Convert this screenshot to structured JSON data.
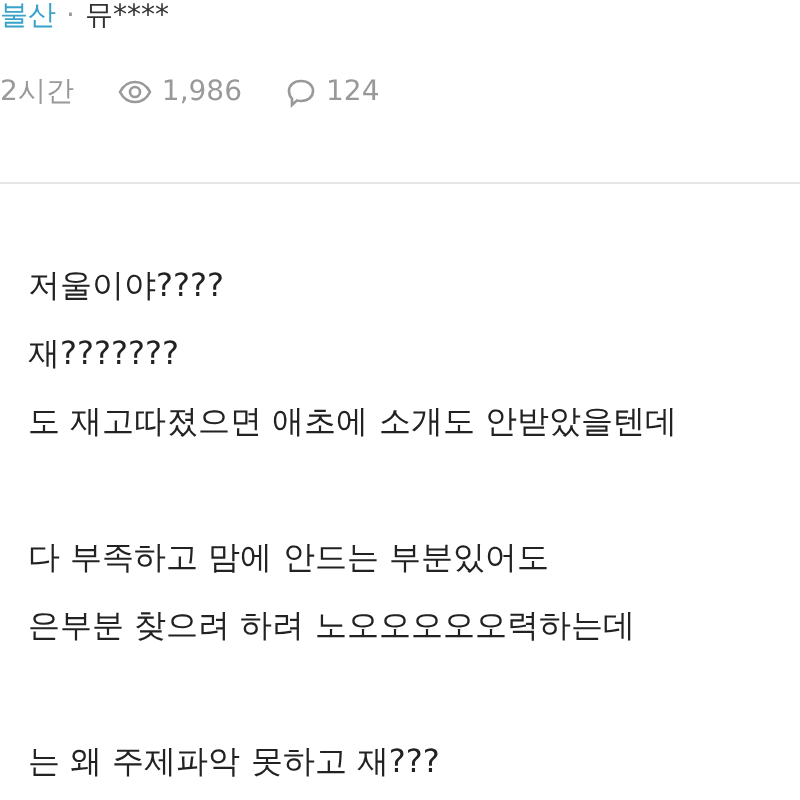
{
  "post_meta": {
    "board": "불산",
    "separator": "·",
    "author": "뮤****"
  },
  "stats": {
    "time": "2시간",
    "views": "1,986",
    "comments": "124"
  },
  "paragraphs": [
    [
      "저울이야????",
      "재???????",
      "도 재고따졌으면 애초에 소개도 안받았을텐데"
    ],
    [
      "다 부족하고 맘에 안드는 부분있어도",
      "은부분 찾으려 하려 노오오오오오력하는데"
    ],
    [
      "는 왜 주제파악 못하고 재???"
    ]
  ]
}
